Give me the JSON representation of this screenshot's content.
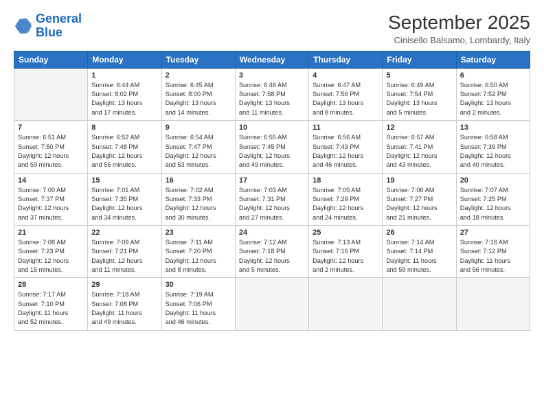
{
  "logo": {
    "line1": "General",
    "line2": "Blue"
  },
  "title": "September 2025",
  "subtitle": "Cinisello Balsamo, Lombardy, Italy",
  "days_header": [
    "Sunday",
    "Monday",
    "Tuesday",
    "Wednesday",
    "Thursday",
    "Friday",
    "Saturday"
  ],
  "weeks": [
    [
      {
        "day": "",
        "info": ""
      },
      {
        "day": "1",
        "info": "Sunrise: 6:44 AM\nSunset: 8:02 PM\nDaylight: 13 hours\nand 17 minutes."
      },
      {
        "day": "2",
        "info": "Sunrise: 6:45 AM\nSunset: 8:00 PM\nDaylight: 13 hours\nand 14 minutes."
      },
      {
        "day": "3",
        "info": "Sunrise: 6:46 AM\nSunset: 7:58 PM\nDaylight: 13 hours\nand 11 minutes."
      },
      {
        "day": "4",
        "info": "Sunrise: 6:47 AM\nSunset: 7:56 PM\nDaylight: 13 hours\nand 8 minutes."
      },
      {
        "day": "5",
        "info": "Sunrise: 6:49 AM\nSunset: 7:54 PM\nDaylight: 13 hours\nand 5 minutes."
      },
      {
        "day": "6",
        "info": "Sunrise: 6:50 AM\nSunset: 7:52 PM\nDaylight: 13 hours\nand 2 minutes."
      }
    ],
    [
      {
        "day": "7",
        "info": "Sunrise: 6:51 AM\nSunset: 7:50 PM\nDaylight: 12 hours\nand 59 minutes."
      },
      {
        "day": "8",
        "info": "Sunrise: 6:52 AM\nSunset: 7:48 PM\nDaylight: 12 hours\nand 56 minutes."
      },
      {
        "day": "9",
        "info": "Sunrise: 6:54 AM\nSunset: 7:47 PM\nDaylight: 12 hours\nand 53 minutes."
      },
      {
        "day": "10",
        "info": "Sunrise: 6:55 AM\nSunset: 7:45 PM\nDaylight: 12 hours\nand 49 minutes."
      },
      {
        "day": "11",
        "info": "Sunrise: 6:56 AM\nSunset: 7:43 PM\nDaylight: 12 hours\nand 46 minutes."
      },
      {
        "day": "12",
        "info": "Sunrise: 6:57 AM\nSunset: 7:41 PM\nDaylight: 12 hours\nand 43 minutes."
      },
      {
        "day": "13",
        "info": "Sunrise: 6:58 AM\nSunset: 7:39 PM\nDaylight: 12 hours\nand 40 minutes."
      }
    ],
    [
      {
        "day": "14",
        "info": "Sunrise: 7:00 AM\nSunset: 7:37 PM\nDaylight: 12 hours\nand 37 minutes."
      },
      {
        "day": "15",
        "info": "Sunrise: 7:01 AM\nSunset: 7:35 PM\nDaylight: 12 hours\nand 34 minutes."
      },
      {
        "day": "16",
        "info": "Sunrise: 7:02 AM\nSunset: 7:33 PM\nDaylight: 12 hours\nand 30 minutes."
      },
      {
        "day": "17",
        "info": "Sunrise: 7:03 AM\nSunset: 7:31 PM\nDaylight: 12 hours\nand 27 minutes."
      },
      {
        "day": "18",
        "info": "Sunrise: 7:05 AM\nSunset: 7:29 PM\nDaylight: 12 hours\nand 24 minutes."
      },
      {
        "day": "19",
        "info": "Sunrise: 7:06 AM\nSunset: 7:27 PM\nDaylight: 12 hours\nand 21 minutes."
      },
      {
        "day": "20",
        "info": "Sunrise: 7:07 AM\nSunset: 7:25 PM\nDaylight: 12 hours\nand 18 minutes."
      }
    ],
    [
      {
        "day": "21",
        "info": "Sunrise: 7:08 AM\nSunset: 7:23 PM\nDaylight: 12 hours\nand 15 minutes."
      },
      {
        "day": "22",
        "info": "Sunrise: 7:09 AM\nSunset: 7:21 PM\nDaylight: 12 hours\nand 11 minutes."
      },
      {
        "day": "23",
        "info": "Sunrise: 7:11 AM\nSunset: 7:20 PM\nDaylight: 12 hours\nand 8 minutes."
      },
      {
        "day": "24",
        "info": "Sunrise: 7:12 AM\nSunset: 7:18 PM\nDaylight: 12 hours\nand 5 minutes."
      },
      {
        "day": "25",
        "info": "Sunrise: 7:13 AM\nSunset: 7:16 PM\nDaylight: 12 hours\nand 2 minutes."
      },
      {
        "day": "26",
        "info": "Sunrise: 7:14 AM\nSunset: 7:14 PM\nDaylight: 11 hours\nand 59 minutes."
      },
      {
        "day": "27",
        "info": "Sunrise: 7:16 AM\nSunset: 7:12 PM\nDaylight: 11 hours\nand 56 minutes."
      }
    ],
    [
      {
        "day": "28",
        "info": "Sunrise: 7:17 AM\nSunset: 7:10 PM\nDaylight: 11 hours\nand 52 minutes."
      },
      {
        "day": "29",
        "info": "Sunrise: 7:18 AM\nSunset: 7:08 PM\nDaylight: 11 hours\nand 49 minutes."
      },
      {
        "day": "30",
        "info": "Sunrise: 7:19 AM\nSunset: 7:06 PM\nDaylight: 11 hours\nand 46 minutes."
      },
      {
        "day": "",
        "info": ""
      },
      {
        "day": "",
        "info": ""
      },
      {
        "day": "",
        "info": ""
      },
      {
        "day": "",
        "info": ""
      }
    ]
  ]
}
